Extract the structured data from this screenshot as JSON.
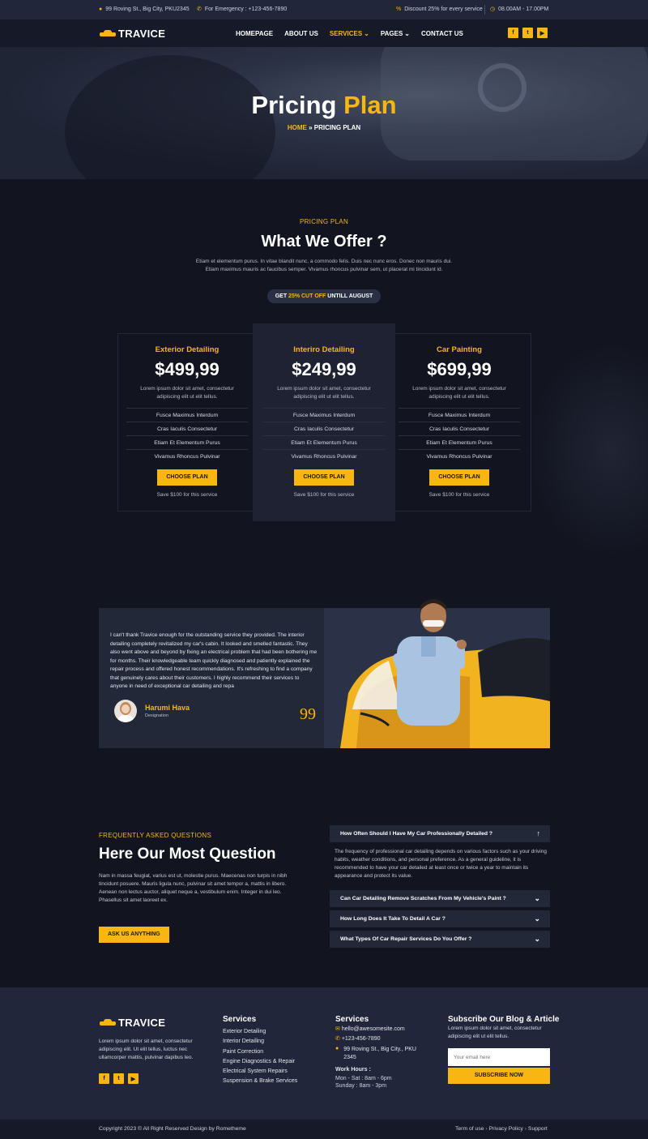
{
  "topbar": {
    "address": "99 Roving St., Big City, PKU2345",
    "emergency": "For Emergency : +123-456-7890",
    "discount": "Discount 25% for every service",
    "hours": "08.00AM - 17.00PM"
  },
  "nav": {
    "logo": "TRAVICE",
    "menu": [
      {
        "label": "HOMEPAGE",
        "active": false
      },
      {
        "label": "ABOUT US",
        "active": false
      },
      {
        "label": "SERVICES",
        "active": true
      },
      {
        "label": "PAGES",
        "active": false
      },
      {
        "label": "CONTACT US",
        "active": false
      }
    ],
    "social_icons": [
      "facebook-icon",
      "twitter-icon",
      "youtube-icon"
    ]
  },
  "hero": {
    "title_white": "Pricing",
    "title_yellow": "Plan",
    "crumb_home": "HOME",
    "crumb_sep": "»",
    "crumb_current": "PRICING PLAN"
  },
  "pricing": {
    "subtitle": "PRICING PLAN",
    "title": "What We Offer ?",
    "desc1": "Etiam et elementum purus. In vitae blandit nunc, a commodo felis. Duis nec nunc eros. Donec non mauris dui.",
    "desc2": "Etiam maximus mauris ac faucibus semper. Vivamus rhoncus pulvinar sem, ut placerat mi tincidunt id.",
    "pill_a": "GET",
    "pill_b": "25% CUT OFF",
    "pill_c": "UNTILL AUGUST",
    "plans": [
      {
        "name": "Exterior Detailing",
        "price": "$499,99",
        "desc1": "Lorem ipsum dolor sit amet, consectetur",
        "desc2": "adipiscing elit ut elit tellus.",
        "features": [
          "Fusce Maximus Interdum",
          "Cras Iaculis Consectetur",
          "Etiam Et Elementum Purus",
          "Vivamus Rhoncus Pulvinar"
        ],
        "button": "CHOOSE PLAN",
        "save": "Save $100 for this service"
      },
      {
        "name": "Interiro Detailing",
        "price": "$249,99",
        "desc1": "Lorem ipsum dolor sit amet, consectetur",
        "desc2": "adipiscing elit ut elit tellus.",
        "features": [
          "Fusce Maximus Interdum",
          "Cras Iaculis Consectetur",
          "Etiam Et Elementum Purus",
          "Vivamus Rhoncus Pulvinar"
        ],
        "button": "CHOOSE PLAN",
        "save": "Save $100 for this service"
      },
      {
        "name": "Car Painting",
        "price": "$699,99",
        "desc1": "Lorem ipsum dolor sit amet, consectetur",
        "desc2": "adipiscing elit ut elit tellus.",
        "features": [
          "Fusce Maximus Interdum",
          "Cras Iaculis Consectetur",
          "Etiam Et Elementum Purus",
          "Vivamus Rhoncus Pulvinar"
        ],
        "button": "CHOOSE PLAN",
        "save": "Save $100 for this service"
      }
    ]
  },
  "testimonial": {
    "quote": "I can't thank Travice enough for the outstanding service they provided. The interior detailing completely revitalized my car's cabin. It looked and smelled fantastic. They also went above and beyond by fixing an electrical problem that had been bothering me for months. Their knowledgeable team quickly diagnosed and patiently explained the repair process and offered honest recommendations. It's refreshing to find a company that genuinely cares about their customers. I highly recommend their services to anyone in need of exceptional car detailing and repa",
    "name": "Harumi Hava",
    "role": "Designation",
    "quote_mark": "99"
  },
  "faq": {
    "subtitle": "FREQUENTLY ASKED QUESTIONS",
    "title": "Here Our Most Question",
    "desc": "Nam in massa feugiat, varius est ut, molestie purus. Maecenas non turpis in nibh tincidunt posuere. Mauris ligula nunc, pulvinar sit amet tempor a, mattis in libero. Aenean non lectus auctor, aliquet neque a, vestibulum enim. Integer in dui leo. Phasellus sit amet laoreet ex.",
    "button": "ASK US ANYTHING",
    "open_question": "How Often Should I Have My Car Professionally Detailed ?",
    "open_answer": "The frequency of professional car detailing depends on various factors such as your driving habits, weather conditions, and personal preference. As a general guideline, it is recommended to have your car detailed at least once or twice a year to maintain its appearance and protect its value.",
    "questions": [
      "Can Car Detailing Remove Scratches From My Vehicle's Paint ?",
      "How Long Does It Take To Detail A Car ?",
      "What Types Of Car Repair Services Do You Offer ?"
    ]
  },
  "footer": {
    "logo": "TRAVICE",
    "about": "Lorem ipsum dolor sit amet, consectetur adipiscing elit. Ut elit tellus, luctus nec ullamcorper mattis, pulvinar dapibus leo.",
    "services_title": "Services",
    "services": [
      "Exterior Detailing",
      "Interior Detailing",
      "Paint Correction",
      "Engine Diagnostics & Repair",
      "Electrical System Repairs",
      "Suspension & Brake Services"
    ],
    "contact_title": "Services",
    "email": "hello@awesomesite.com",
    "phone": "+123-456-7890",
    "address": "99 Roving St., Big City., PKU 2345",
    "work_hours_title": "Work Hours :",
    "hours1": "Mon - Sat : 8am - 6pm",
    "hours2": "Sunday : 8am - 3pm",
    "subscribe_title": "Subscribe Our Blog & Article",
    "subscribe_desc": "Lorem ipsum dolor sit amet, consectetur adipiscing elit ut elit tellus.",
    "email_placeholder": "Your email here",
    "subscribe_button": "SUBSCRIBE NOW",
    "copyright": "Copyright 2023 © All Right Reserved Design by Rometheme",
    "links": [
      "Term of use",
      "Privacy Policy",
      "Support"
    ]
  },
  "colors": {
    "accent": "#f9b612",
    "bg": "#121420",
    "panel": "#232839"
  }
}
